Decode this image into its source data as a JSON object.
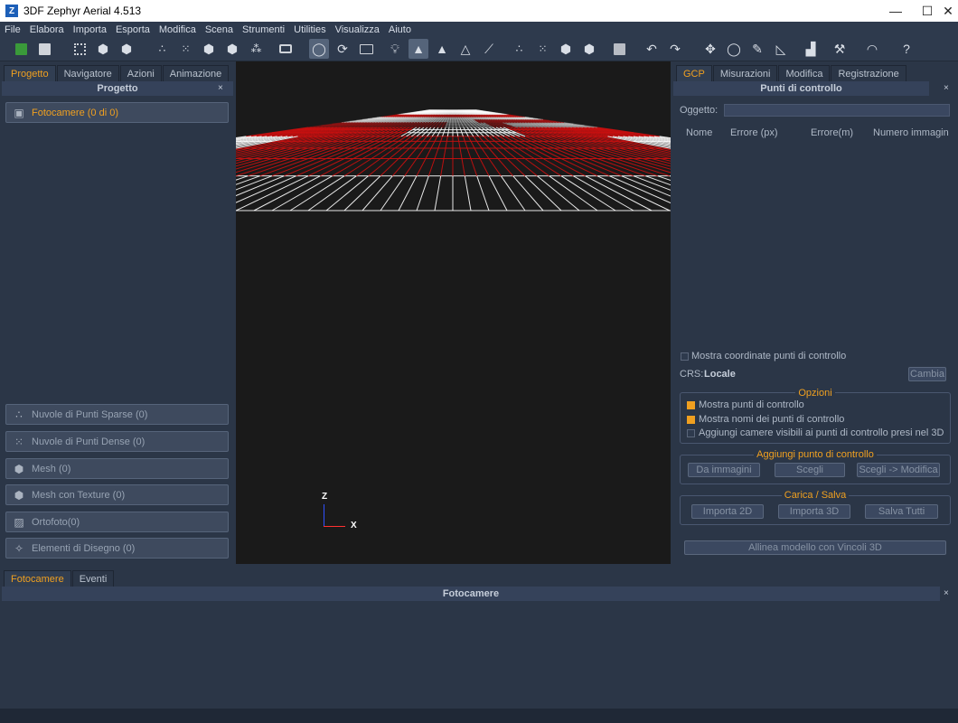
{
  "window": {
    "title": "3DF Zephyr Aerial 4.513",
    "logo": "Z",
    "minimize": "—",
    "maximize": "☐",
    "close": "✕"
  },
  "menu": [
    "File",
    "Elabora",
    "Importa",
    "Esporta",
    "Modifica",
    "Scena",
    "Strumenti",
    "Utilities",
    "Visualizza",
    "Aiuto"
  ],
  "toolbar": {
    "icons": [
      "new-project-icon",
      "save-icon",
      "select-icon",
      "box-icon",
      "cube-icon",
      "sparse-cloud-icon",
      "dense-cloud-icon",
      "mesh-icon",
      "textured-mesh-icon",
      "filter-icon",
      "camera-icon",
      "orbit-icon",
      "rotate-icon",
      "image-icon",
      "light-icon",
      "triangle-solid-icon",
      "triangle-icon",
      "triangle-wire-icon",
      "brush-icon",
      "points-icon",
      "points-dense-icon",
      "cube-solid-icon",
      "cube-texture-icon",
      "square-icon",
      "undo-icon",
      "redo-icon",
      "transform-icon",
      "lasso-icon",
      "pen-icon",
      "ruler-icon",
      "chart-icon",
      "tool-icon",
      "mask-icon",
      "help-icon"
    ]
  },
  "left_panel": {
    "tabs": [
      "Progetto",
      "Navigatore",
      "Azioni",
      "Animazione"
    ],
    "title": "Progetto",
    "close": "×",
    "items": [
      {
        "label": "Fotocamere (0 di 0)",
        "icon": "camera-icon"
      },
      {
        "label": "Nuvole di Punti Sparse (0)",
        "icon": "sparse-cloud-icon"
      },
      {
        "label": "Nuvole di Punti Dense (0)",
        "icon": "dense-cloud-icon"
      },
      {
        "label": "Mesh (0)",
        "icon": "mesh-icon"
      },
      {
        "label": "Mesh con Texture (0)",
        "icon": "textured-mesh-icon"
      },
      {
        "label": "Ortofoto(0)",
        "icon": "orthophoto-icon"
      },
      {
        "label": "Elementi di Disegno (0)",
        "icon": "drawing-icon"
      }
    ]
  },
  "viewport": {
    "axis_z": "Z",
    "axis_x": "X"
  },
  "right_panel": {
    "tabs": [
      "GCP",
      "Misurazioni",
      "Modifica",
      "Registrazione"
    ],
    "title": "Punti di controllo",
    "close": "×",
    "oggetto_label": "Oggetto:",
    "columns": [
      "Nome",
      "Errore (px)",
      "Errore(m)",
      "Numero immagin"
    ],
    "show_coords": "Mostra coordinate punti di controllo",
    "crs_label": "CRS:",
    "crs_value": "Locale",
    "change_button": "Cambia",
    "options": {
      "title": "Opzioni",
      "items": [
        {
          "label": "Mostra punti di controllo",
          "checked": true
        },
        {
          "label": "Mostra nomi dei punti di controllo",
          "checked": true
        },
        {
          "label": "Aggiungi camere visibili ai punti di controllo presi nel 3D",
          "checked": false
        }
      ]
    },
    "add_point": {
      "title": "Aggiungi punto di controllo",
      "buttons": [
        "Da immagini",
        "Scegli",
        "Scegli -> Modifica"
      ]
    },
    "load_save": {
      "title": "Carica / Salva",
      "buttons": [
        "Importa 2D",
        "Importa 3D",
        "Salva Tutti"
      ]
    },
    "align_button": "Allinea modello con Vincoli 3D"
  },
  "bottom_panel": {
    "tabs": [
      "Fotocamere",
      "Eventi"
    ],
    "title": "Fotocamere",
    "close": "×"
  },
  "colors": {
    "accent": "#f0a020",
    "panel": "#2b3647",
    "grid_white": "#ffffff",
    "grid_red": "#cc1010"
  }
}
